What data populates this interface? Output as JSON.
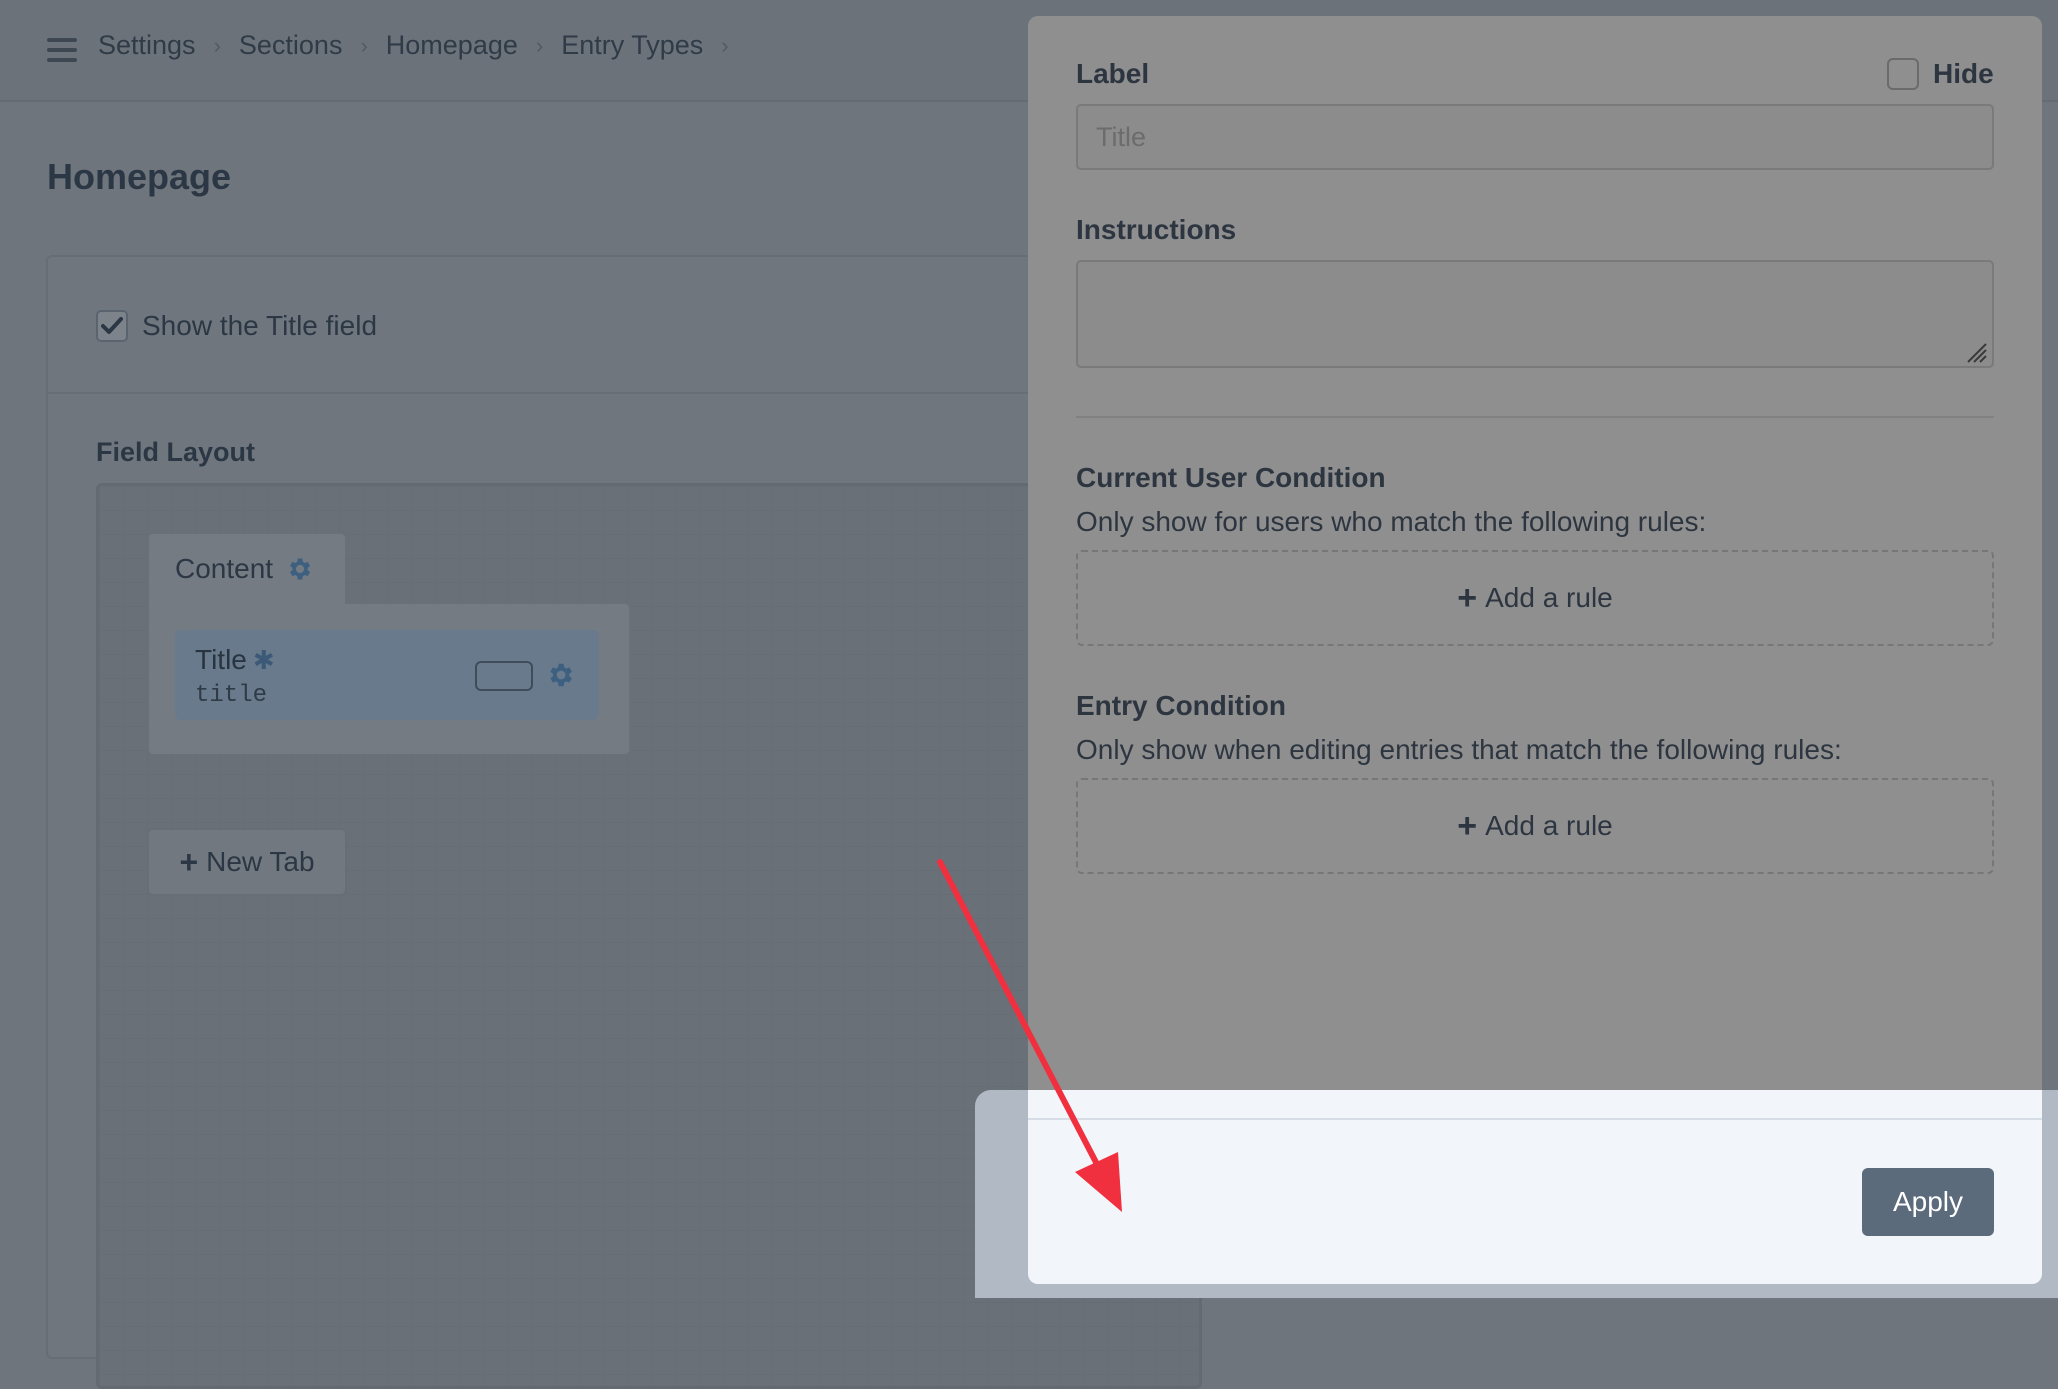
{
  "breadcrumbs": [
    "Settings",
    "Sections",
    "Homepage",
    "Entry Types"
  ],
  "page": {
    "title": "Homepage"
  },
  "entry_type": {
    "show_title_label": "Show the Title field",
    "show_title_checked": true,
    "field_layout_label": "Field Layout",
    "tabs": [
      {
        "label": "Content",
        "fields": [
          {
            "name": "Title",
            "required_marker": "✱",
            "handle": "title"
          }
        ]
      }
    ],
    "new_tab_label": "New Tab"
  },
  "slideout": {
    "label_heading": "Label",
    "hide_label": "Hide",
    "label_placeholder": "Title",
    "instructions_heading": "Instructions",
    "current_user_condition": {
      "title": "Current User Condition",
      "description": "Only show for users who match the following rules:",
      "add_rule": "Add a rule"
    },
    "entry_condition": {
      "title": "Entry Condition",
      "description": "Only show when editing entries that match the following rules:",
      "add_rule": "Add a rule"
    },
    "apply_label": "Apply"
  },
  "colors": {
    "overlay": "#6f757d",
    "slideout_bg": "#8f8f8f",
    "footer_bg": "#f2f5f9",
    "apply_button": "#5b6b7c",
    "annotation_arrow": "#f0303f"
  }
}
